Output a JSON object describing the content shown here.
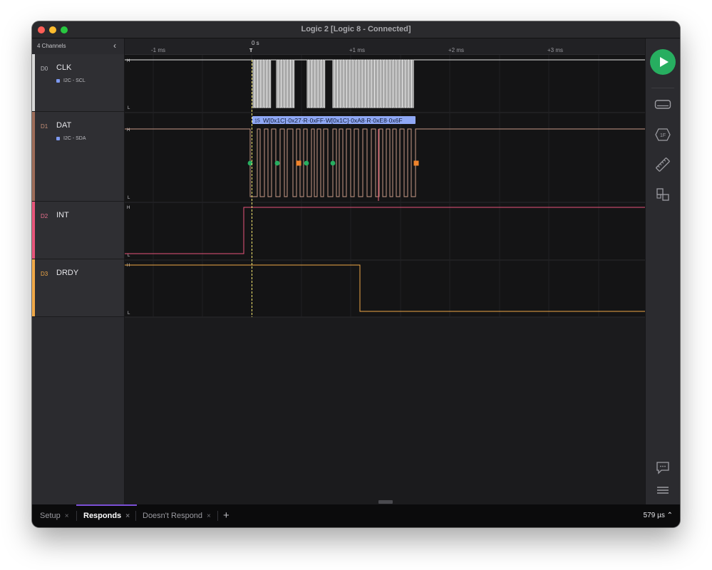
{
  "window": {
    "title": "Logic 2 [Logic 8 - Connected]"
  },
  "sidebar": {
    "header": "4 Channels",
    "channels": [
      {
        "id": "D0",
        "name": "CLK",
        "analyzer": "I2C - SCL",
        "color": "#e0e0e0",
        "num_color": "#b8b8bd"
      },
      {
        "id": "D1",
        "name": "DAT",
        "analyzer": "I2C - SDA",
        "color": "#9f6e5b",
        "num_color": "#c48f77"
      },
      {
        "id": "D2",
        "name": "INT",
        "analyzer": "",
        "color": "#e8557a",
        "num_color": "#e86f8d"
      },
      {
        "id": "D3",
        "name": "DRDY",
        "analyzer": "",
        "color": "#f1a948",
        "num_color": "#f1a948"
      }
    ]
  },
  "timeline": {
    "ticks": [
      "-1 ms",
      "0 s",
      "+1 ms",
      "+2 ms",
      "+3 ms"
    ],
    "trigger_label": "T",
    "high_label": "H",
    "low_label": "L"
  },
  "decode": {
    "index": "15",
    "text": "W[0x1C]·0x27·R·0xFF·W[0x1C]·0xA8·R·0xE8·0x6F"
  },
  "colors": {
    "clk": "#e8e8e8",
    "dat": "#c89a86",
    "int": "#e8557a",
    "drdy": "#f1a948",
    "decode_bg": "#8fa8f5",
    "start_marker": "#27ae60",
    "stop_marker": "#f0842c",
    "trigger": "#f3e46a"
  },
  "toolbar": {
    "tools": [
      "analyzers-icon",
      "extensions-icon",
      "measure-icon",
      "layout-icon"
    ],
    "bottom": [
      "comment-icon",
      "menu-icon"
    ]
  },
  "tabs": [
    {
      "label": "Setup",
      "active": false
    },
    {
      "label": "Responds",
      "active": true
    },
    {
      "label": "Doesn't Respond",
      "active": false
    }
  ],
  "status": {
    "time": "579 µs ⌃"
  }
}
